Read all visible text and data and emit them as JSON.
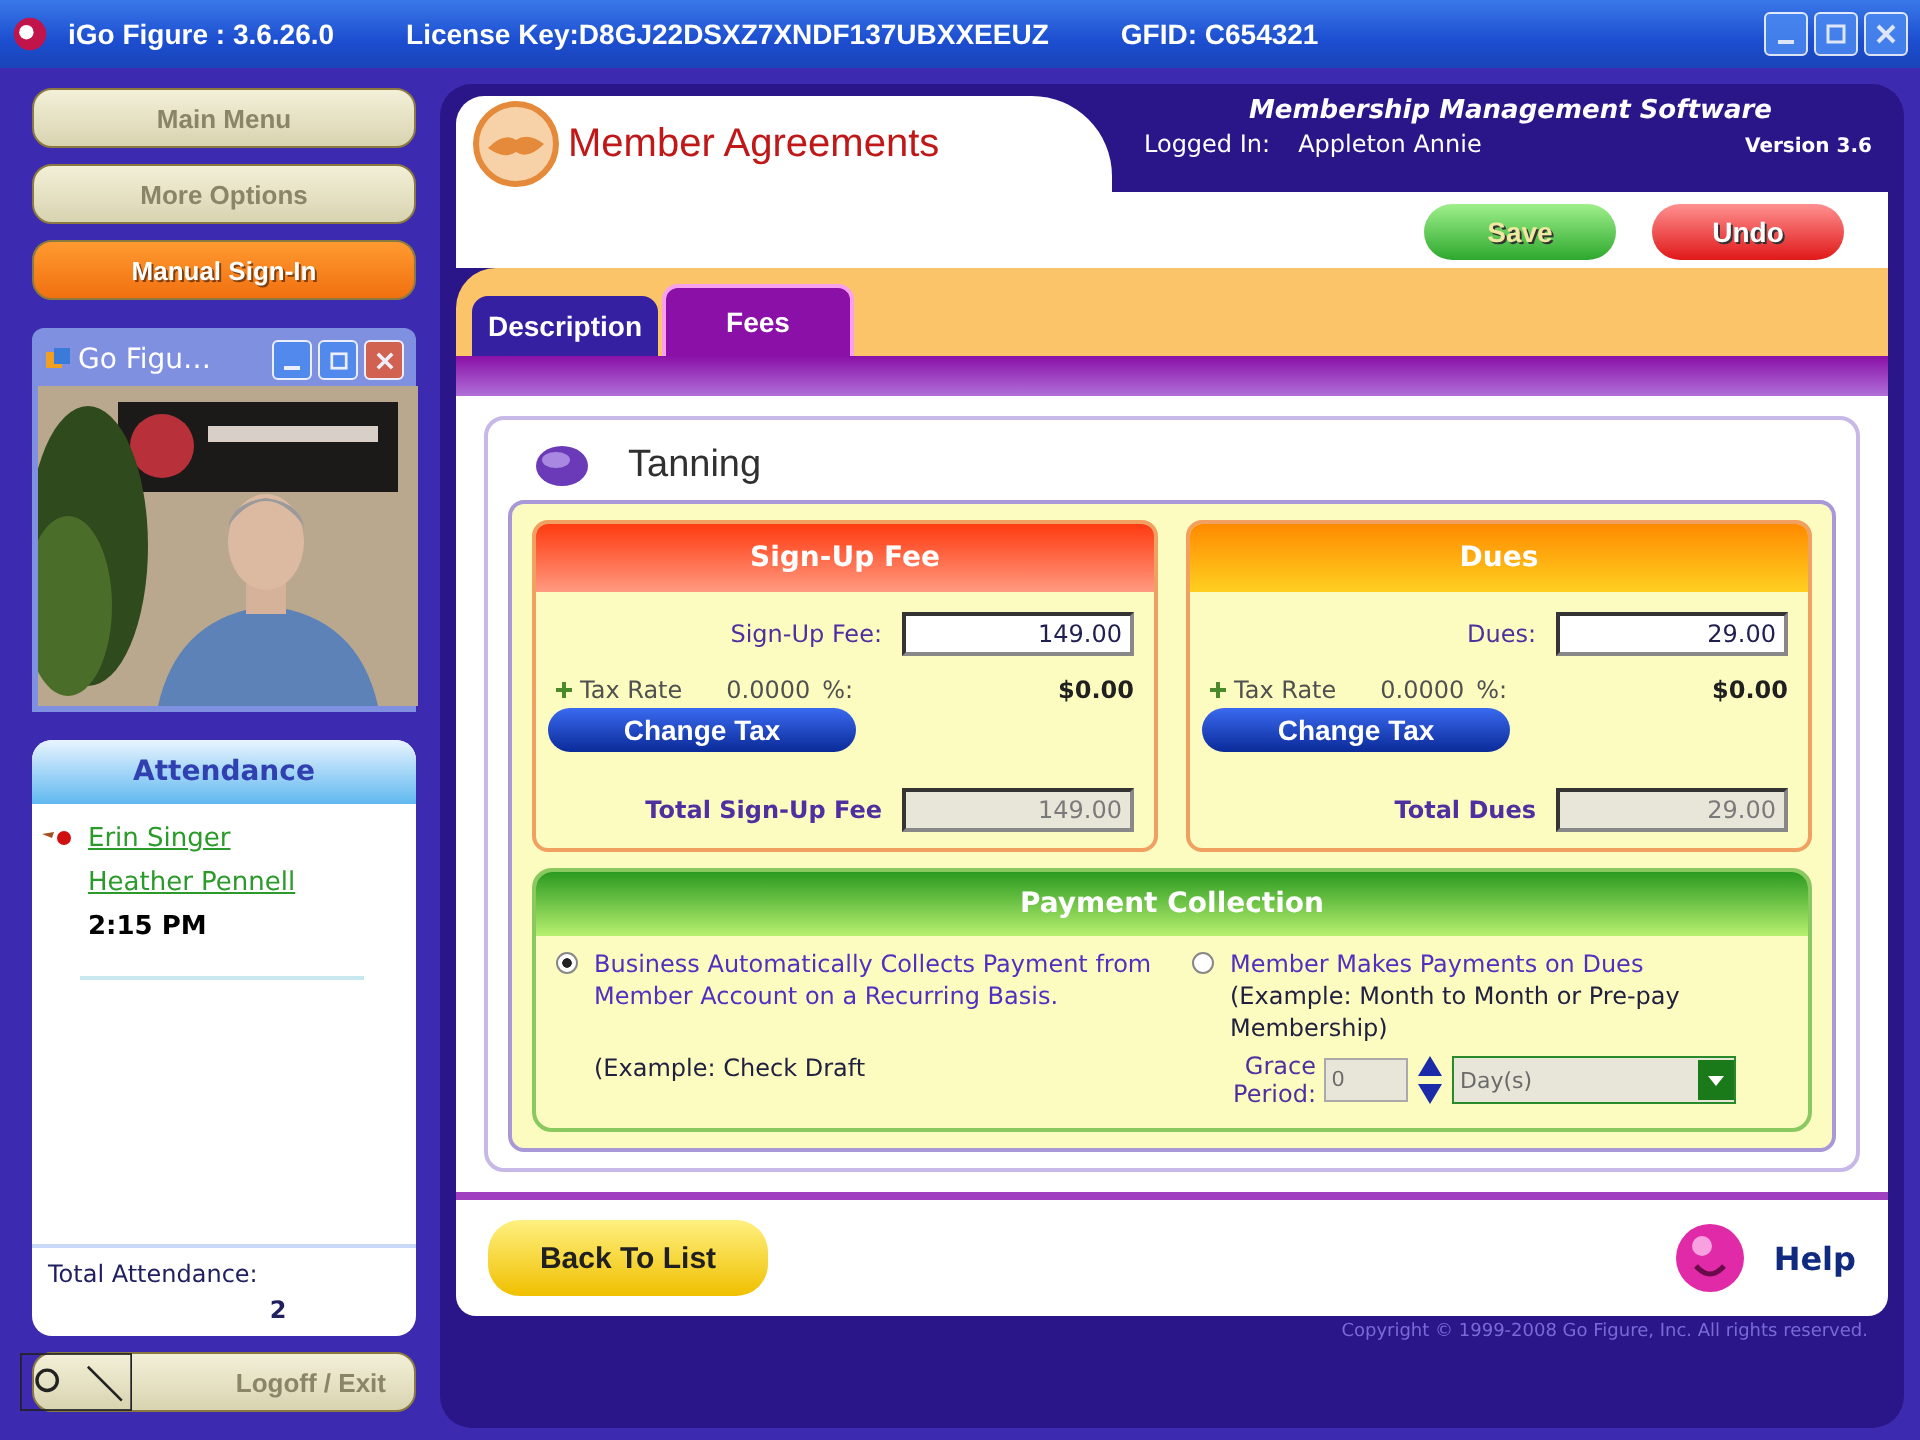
{
  "window": {
    "title": "iGo Figure : 3.6.26.0",
    "license": "License Key:D8GJ22DSXZ7XNDF137UBXXEEUZ",
    "gfid": "GFID: C654321"
  },
  "nav": [
    {
      "label": "Main Menu",
      "disabled": true
    },
    {
      "label": "More Options",
      "disabled": true
    },
    {
      "label": "Manual Sign-In",
      "disabled": false
    }
  ],
  "video_window": {
    "title": "Go Figu…"
  },
  "attendance": {
    "title": "Attendance",
    "members": [
      {
        "name": "Erin Singer",
        "flagged": true
      },
      {
        "name": "Heather Pennell",
        "flagged": false
      }
    ],
    "time": "2:15 PM",
    "total_label": "Total Attendance:",
    "total": "2"
  },
  "logoff": {
    "label": "Logoff / Exit"
  },
  "header": {
    "title": "Member Agreements",
    "product": "Membership Management Software",
    "logged_in_label": "Logged In:",
    "user": "Appleton Annie",
    "version": "Version 3.6"
  },
  "actions": [
    {
      "label": "Save",
      "kind": "save"
    },
    {
      "label": "Undo",
      "kind": "undo"
    }
  ],
  "tabs": [
    {
      "label": "Description",
      "selected": false
    },
    {
      "label": "Fees",
      "selected": true
    }
  ],
  "agreement": {
    "name": "Tanning"
  },
  "fee_boxes": [
    {
      "kind": "signup",
      "title": "Sign-Up Fee",
      "amount_label": "Sign-Up Fee:",
      "amount": "149.00",
      "tax_label": "Tax Rate",
      "tax_rate": "0.0000",
      "tax_unit": "%:",
      "tax_amount": "$0.00",
      "button": "Change Tax",
      "total_label": "Total Sign-Up Fee",
      "total": "149.00"
    },
    {
      "kind": "dues",
      "title": "Dues",
      "amount_label": "Dues:",
      "amount": "29.00",
      "tax_label": "Tax Rate",
      "tax_rate": "0.0000",
      "tax_unit": "%:",
      "tax_amount": "$0.00",
      "button": "Change Tax",
      "total_label": "Total Dues",
      "total": "29.00"
    }
  ],
  "payment_collection": {
    "title": "Payment Collection",
    "options": [
      {
        "text": "Business Automatically Collects Payment from Member Account on a Recurring Basis.",
        "example": "(Example: Check Draft",
        "selected": true
      },
      {
        "text": "Member Makes Payments on Dues",
        "example": "(Example: Month to Month or Pre-pay Membership)",
        "selected": false
      }
    ],
    "grace": {
      "label": "Grace Period:",
      "value": "0",
      "unit": "Day(s)",
      "disabled": true
    }
  },
  "footer": {
    "back": "Back To List",
    "help": "Help",
    "copyright": "Copyright © 1999-2008 Go Figure, Inc.  All rights reserved."
  }
}
